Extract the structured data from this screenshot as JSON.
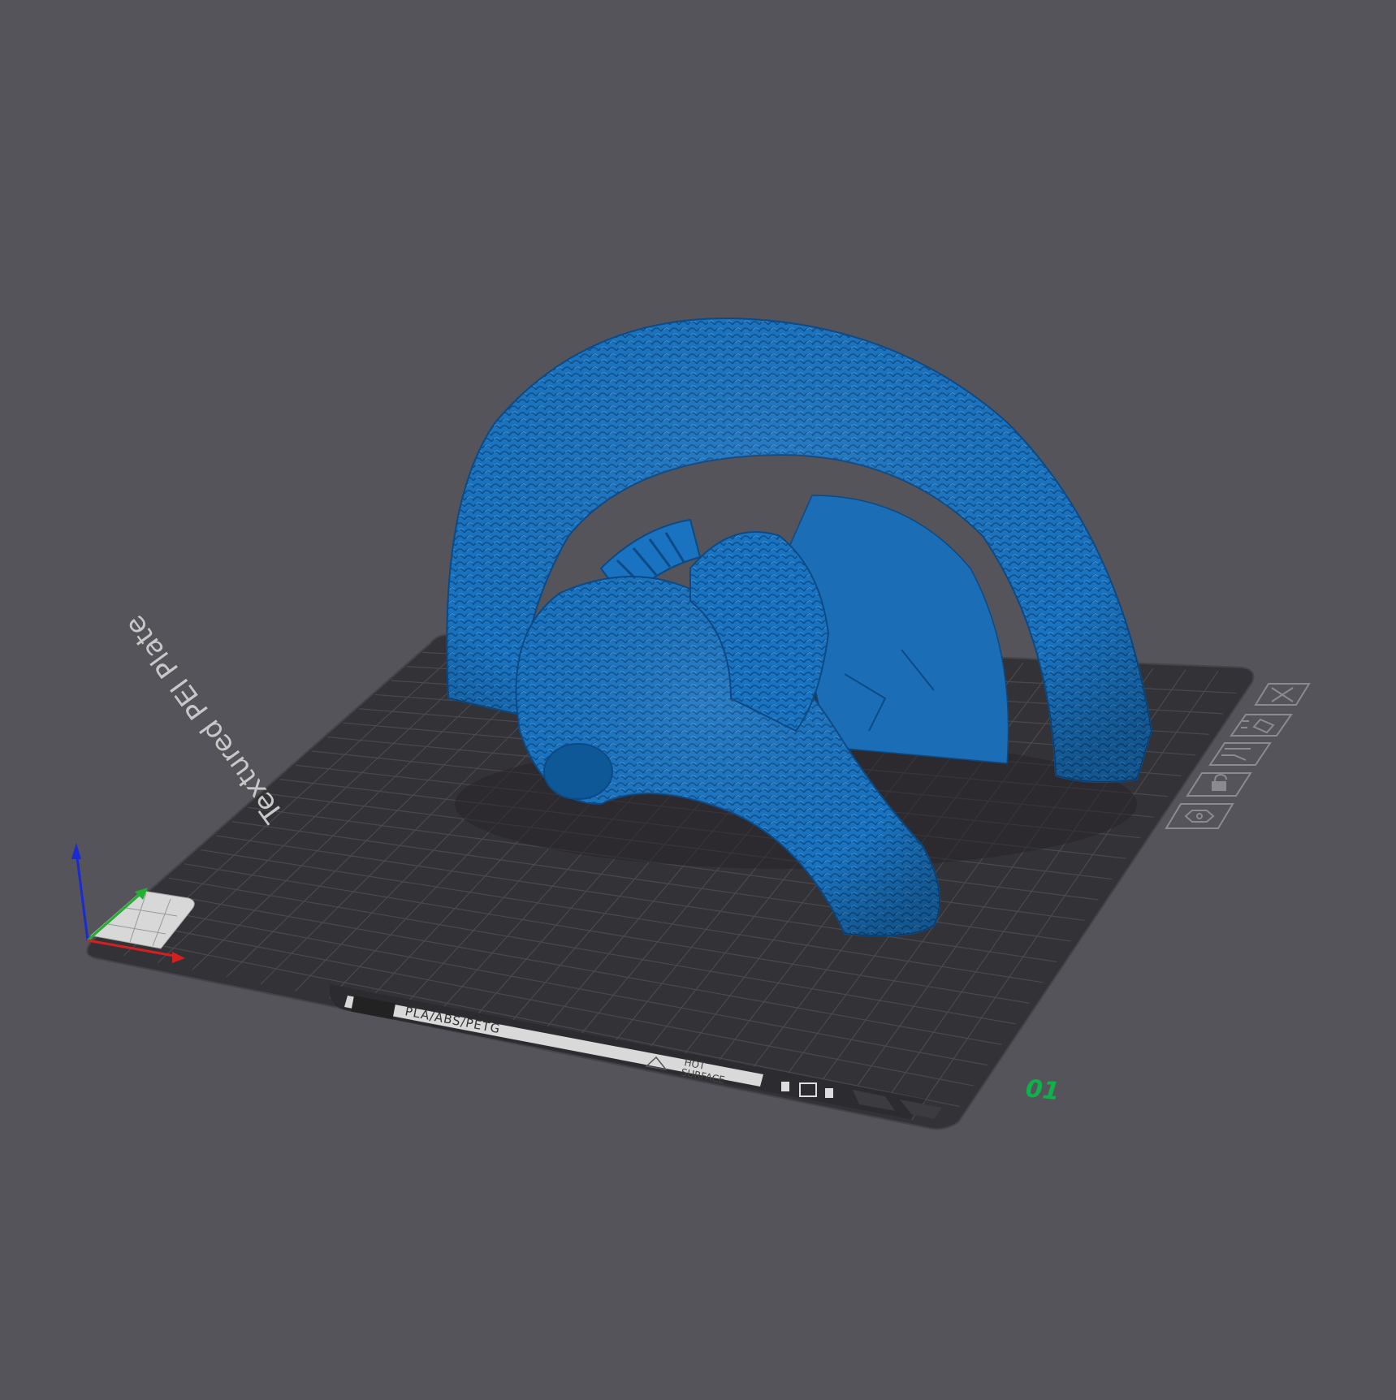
{
  "viewport": {
    "background": "#55545a",
    "model_color": "#1a73c0"
  },
  "plate": {
    "name_text": "Textured PEI Plate",
    "material_text": "PLA/ABS/PETG",
    "warning_text_line1": "HOT",
    "warning_text_line2": "SURFACE",
    "plate_number": "01",
    "plate_number_color": "#10b04a"
  },
  "plate_toolbar": {
    "icons": [
      {
        "name": "close-plate-icon"
      },
      {
        "name": "arrange-icon"
      },
      {
        "name": "orient-icon"
      },
      {
        "name": "lock-icon"
      },
      {
        "name": "settings-icon"
      }
    ]
  },
  "axes": {
    "x_color": "#d42020",
    "y_color": "#22b030",
    "z_color": "#1a2ad4"
  }
}
